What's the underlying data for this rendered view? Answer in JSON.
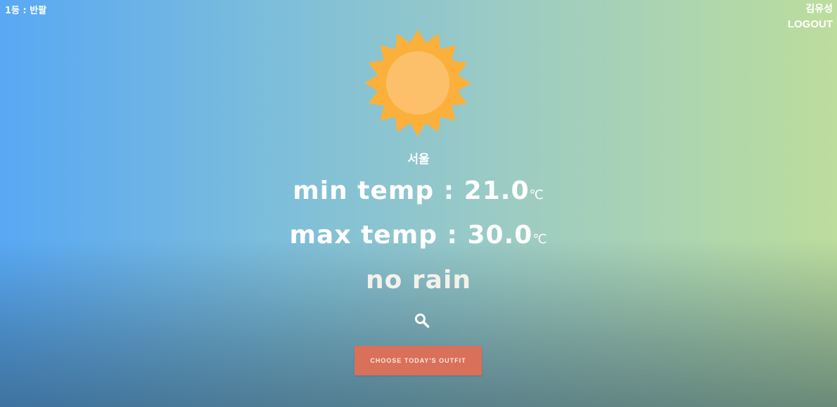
{
  "header": {
    "rank_label": "1등 : 반팔",
    "user_name": "김유성",
    "logout_label": "LOGOUT"
  },
  "weather": {
    "icon": "sun-icon",
    "city": "서울",
    "min_label": "min temp : 21.0",
    "max_label": "max temp : 30.0",
    "unit": "℃",
    "rain_label": "no rain"
  },
  "actions": {
    "search_icon": "search-icon",
    "outfit_button_label": "CHOOSE TODAY'S OUTFIT"
  },
  "colors": {
    "sun_outer": "#fbb03b",
    "sun_inner": "#fdc06a",
    "button": "#d9705a"
  }
}
